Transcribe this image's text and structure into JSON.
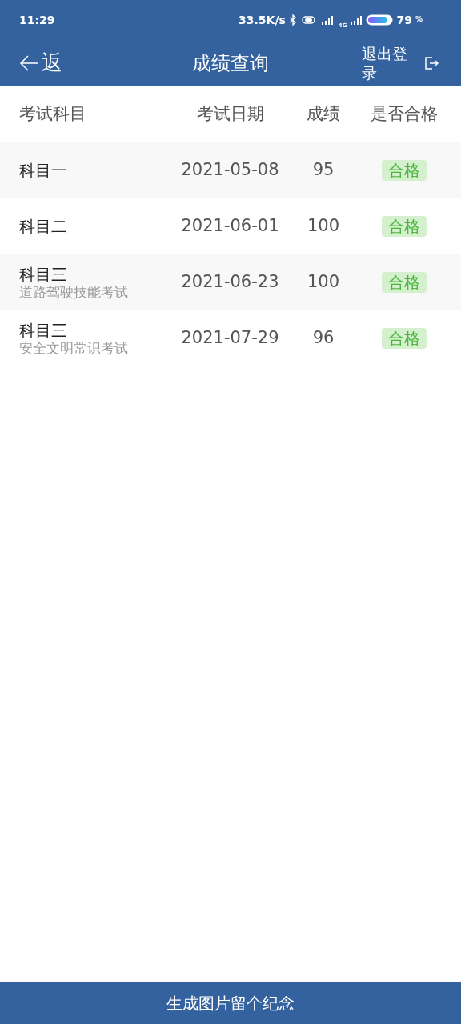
{
  "status_bar": {
    "time": "11:29",
    "speed": "33.5K/s",
    "network": "4G",
    "battery": "79",
    "battery_unit": "%"
  },
  "header": {
    "back": "返",
    "title": "成绩查询",
    "logout": "退出登录"
  },
  "table": {
    "columns": [
      "考试科目",
      "考试日期",
      "成绩",
      "是否合格"
    ],
    "rows": [
      {
        "subject": "科目一",
        "date": "2021-05-08",
        "score": "95",
        "result": "合格"
      },
      {
        "subject": "科目二",
        "date": "2021-06-01",
        "score": "100",
        "result": "合格"
      },
      {
        "subject": "科目三",
        "subtitle": "道路驾驶技能考试",
        "date": "2021-06-23",
        "score": "100",
        "result": "合格"
      },
      {
        "subject": "科目三",
        "subtitle": "安全文明常识考试",
        "date": "2021-07-29",
        "score": "96",
        "result": "合格"
      }
    ]
  },
  "footer_button": "生成图片留个纪念"
}
